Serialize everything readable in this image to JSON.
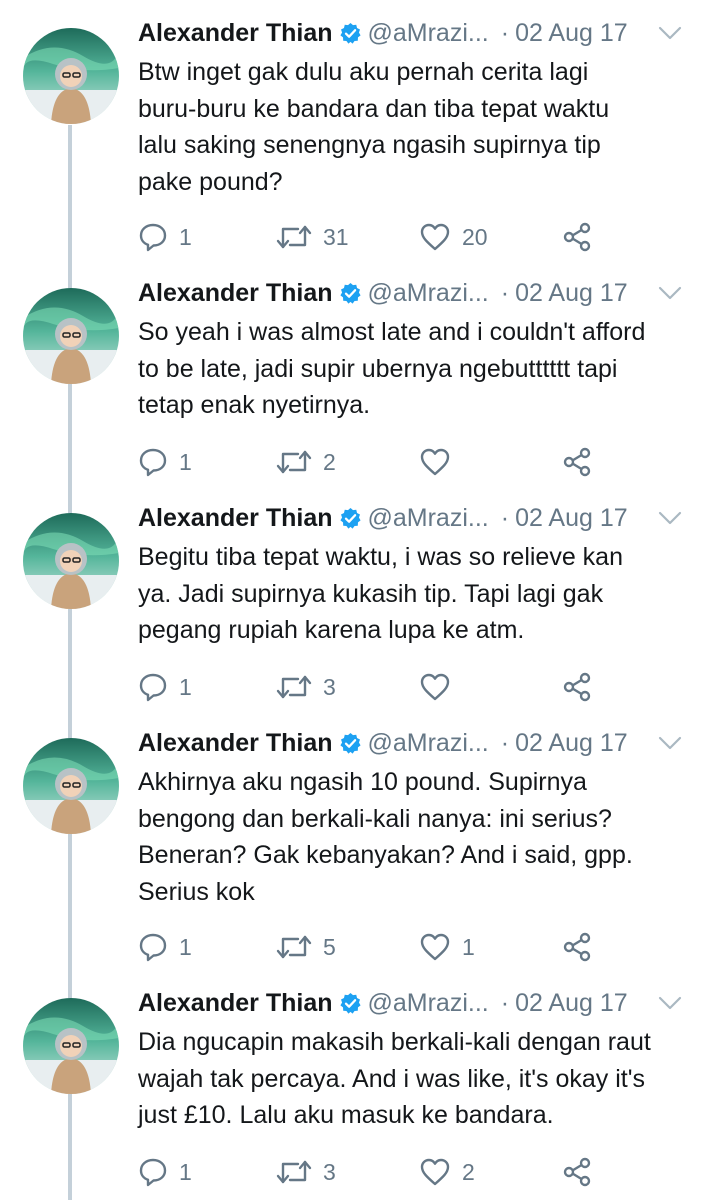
{
  "colors": {
    "text": "#14171a",
    "secondary": "#657786",
    "verified": "#1da1f2",
    "thread_line": "#c4d0d9"
  },
  "tweets": [
    {
      "name": "Alexander Thian",
      "handle": "@aMrazi...",
      "dot": "·",
      "date": "02 Aug 17",
      "lines": [
        "Btw inget gak dulu aku pernah cerita lagi",
        "buru-buru ke bandara dan tiba tepat waktu",
        "lalu saking senengnya ngasih supirnya tip",
        "pake pound?"
      ],
      "replies": "1",
      "retweets": "31",
      "likes": "20"
    },
    {
      "name": "Alexander Thian",
      "handle": "@aMrazi...",
      "dot": "·",
      "date": "02 Aug 17",
      "lines": [
        "So yeah i was almost late and i couldn't afford",
        "to be late, jadi supir ubernya ngebutttttt tapi",
        "tetap enak nyetirnya."
      ],
      "replies": "1",
      "retweets": "2",
      "likes": ""
    },
    {
      "name": "Alexander Thian",
      "handle": "@aMrazi...",
      "dot": "·",
      "date": "02 Aug 17",
      "lines": [
        "Begitu tiba tepat waktu, i was so relieve kan",
        "ya. Jadi supirnya kukasih tip. Tapi lagi gak",
        "pegang rupiah karena lupa ke atm."
      ],
      "replies": "1",
      "retweets": "3",
      "likes": ""
    },
    {
      "name": "Alexander Thian",
      "handle": "@aMrazi...",
      "dot": "·",
      "date": "02 Aug 17",
      "lines": [
        "Akhirnya aku ngasih 10 pound. Supirnya",
        "bengong dan berkali-kali nanya: ini serius?",
        "Beneran? Gak kebanyakan? And i said, gpp.",
        "Serius kok"
      ],
      "replies": "1",
      "retweets": "5",
      "likes": "1"
    },
    {
      "name": "Alexander Thian",
      "handle": "@aMrazi...",
      "dot": "·",
      "date": "02 Aug 17",
      "lines": [
        "Dia ngucapin makasih berkali-kali dengan raut",
        "wajah tak percaya. And i was like, it's okay it's",
        "just £10. Lalu aku masuk ke bandara."
      ],
      "replies": "1",
      "retweets": "3",
      "likes": "2"
    }
  ]
}
